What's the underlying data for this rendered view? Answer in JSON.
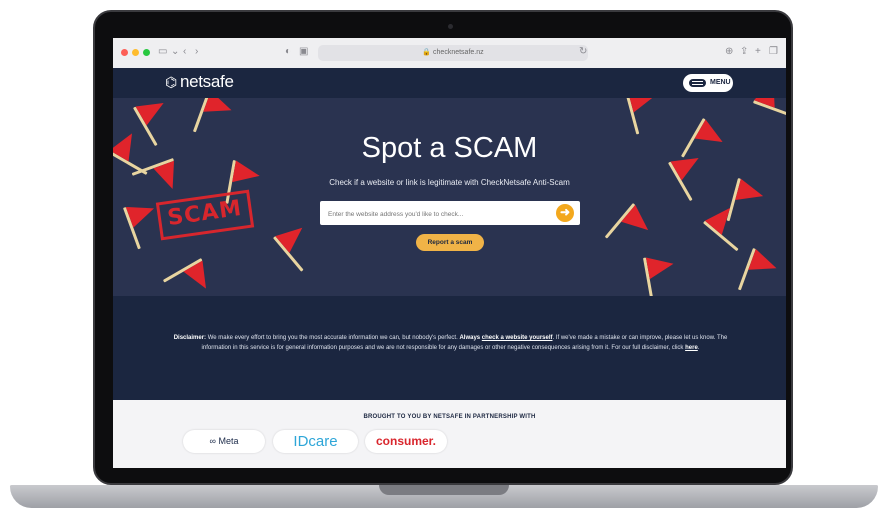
{
  "browser": {
    "url": "checknetsafe.nz"
  },
  "nav": {
    "logo_text": "netsafe",
    "menu_label": "MENU"
  },
  "hero": {
    "title": "Spot a SCAM",
    "subtitle": "Check if a website or link is legitimate with CheckNetsafe Anti-Scam",
    "search_placeholder": "Enter the website address you'd like to check...",
    "report_label": "Report a scam",
    "stamp_text": "SCAM"
  },
  "disclaimer": {
    "label": "Disclaimer:",
    "text_1": " We make every effort to bring you the most accurate information we can, but nobody's perfect. ",
    "always": "Always",
    "link_check": "check a website yourself",
    "text_2": ". If we've made a mistake or can improve, please let us know. The information in this service is for general information purposes and we are not responsible for any damages or other negative consequences arising from it. For our full disclaimer, click ",
    "link_here": "here"
  },
  "partners": {
    "title": "BROUGHT TO YOU BY NETSAFE IN PARTNERSHIP WITH",
    "items": [
      "Meta",
      "IDcare",
      "consumer."
    ]
  },
  "colors": {
    "navy": "#1b2640",
    "hero_bg": "#2a3350",
    "accent_orange": "#f3a81d",
    "flag_red": "#e0242b"
  },
  "icons": [
    "netsafe-logo-icon",
    "hamburger-icon",
    "arrow-right-icon",
    "meta-logo-icon"
  ]
}
